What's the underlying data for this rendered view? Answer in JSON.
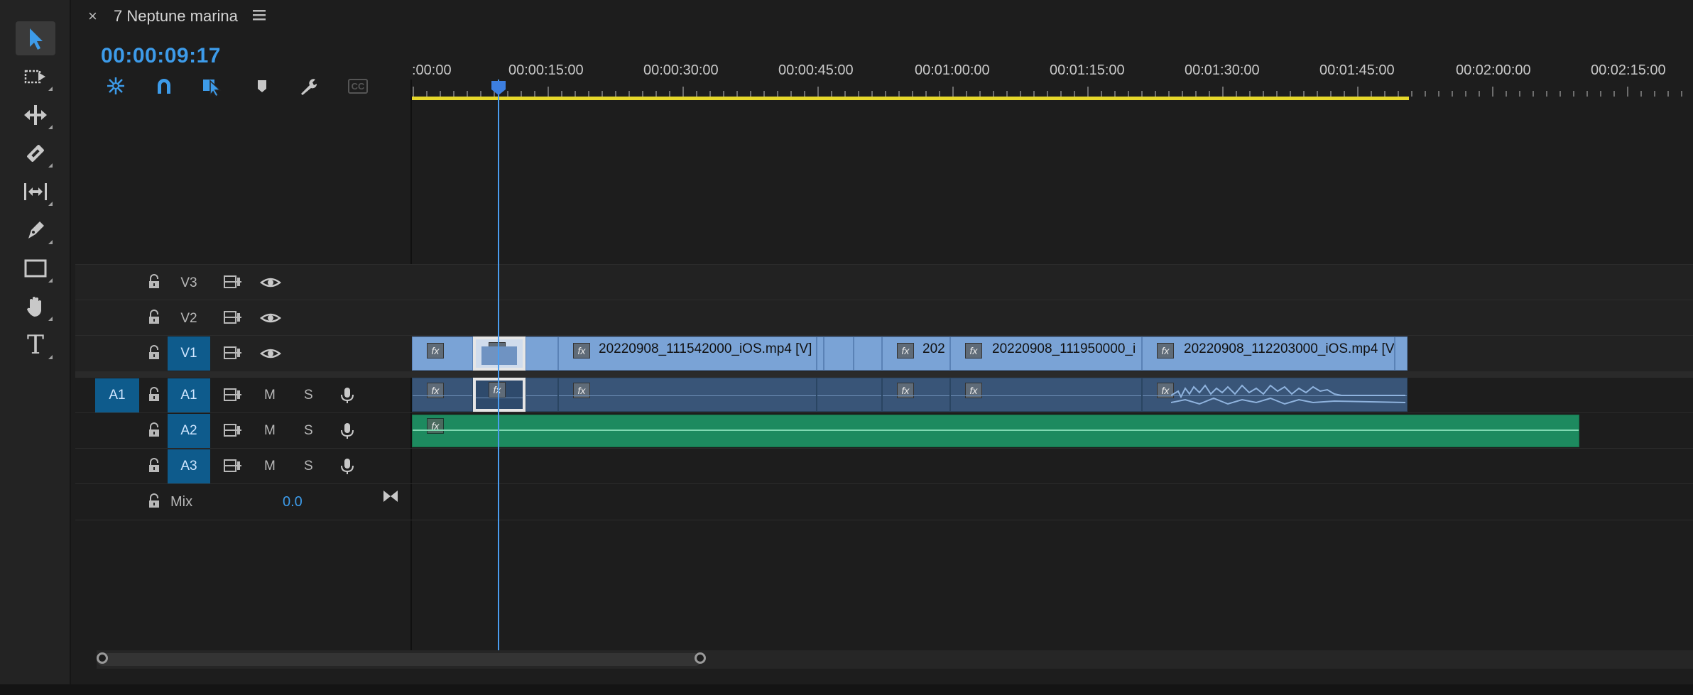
{
  "panel": {
    "close_glyph": "×",
    "title": "7 Neptune marina",
    "menu_icon": "hamburger-icon"
  },
  "timecode": "00:00:09:17",
  "header_tools": [
    {
      "name": "insert-nest-icon"
    },
    {
      "name": "snap-magnet-icon"
    },
    {
      "name": "linked-selection-icon"
    },
    {
      "name": "add-marker-icon"
    },
    {
      "name": "wrench-settings-icon"
    },
    {
      "name": "captions-cc-icon",
      "label": "CC"
    }
  ],
  "tools": [
    {
      "name": "selection-tool-icon"
    },
    {
      "name": "track-select-tool-icon"
    },
    {
      "name": "ripple-edit-tool-icon"
    },
    {
      "name": "razor-tool-icon"
    },
    {
      "name": "slip-tool-icon"
    },
    {
      "name": "pen-tool-icon"
    },
    {
      "name": "rectangle-tool-icon"
    },
    {
      "name": "hand-tool-icon"
    },
    {
      "name": "type-tool-icon",
      "glyph": "T"
    }
  ],
  "ruler": {
    "labels": [
      ":00:00",
      "00:00:15:00",
      "00:00:30:00",
      "00:00:45:00",
      "00:01:00:00",
      "00:01:15:00",
      "00:01:30:00",
      "00:01:45:00",
      "00:02:00:00",
      "00:02:15:00"
    ]
  },
  "tracks": {
    "video": [
      {
        "label": "V3",
        "targeted": false
      },
      {
        "label": "V2",
        "targeted": false
      },
      {
        "label": "V1",
        "targeted": true
      }
    ],
    "audio": [
      {
        "source": "A1",
        "label": "A1",
        "mute": "M",
        "solo": "S"
      },
      {
        "source": "",
        "label": "A2",
        "mute": "M",
        "solo": "S"
      },
      {
        "source": "",
        "label": "A3",
        "mute": "M",
        "solo": "S"
      }
    ],
    "mix": {
      "label": "Mix",
      "value": "0.0"
    }
  },
  "clips": {
    "fx_glyph": "fx",
    "video": [
      {
        "name": ""
      },
      {
        "name": ""
      },
      {
        "name": "20220908_111542000_iOS.mp4 [V]"
      },
      {
        "name": "202"
      },
      {
        "name": "20220908_111950000_i"
      },
      {
        "name": "20220908_112203000_iOS.mp4 [V]"
      }
    ]
  },
  "colors": {
    "accent_blue": "#3d9be9",
    "video_clip": "#7aa3d6",
    "audio_clip": "#395578",
    "music_clip": "#1d8a5f",
    "work_area": "#e5d72a"
  }
}
